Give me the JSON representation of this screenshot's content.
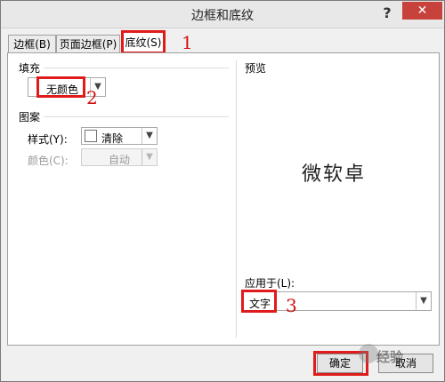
{
  "window": {
    "title": "边框和底纹",
    "help_label": "?",
    "close_label": "✕"
  },
  "tabs": [
    {
      "label": "边框(B)"
    },
    {
      "label": "页面边框(P)"
    },
    {
      "label": "底纹(S)"
    }
  ],
  "markers": {
    "m1": "1",
    "m2": "2",
    "m3": "3"
  },
  "fill": {
    "label": "填充",
    "color_value": "无颜色"
  },
  "pattern": {
    "label": "图案",
    "style_label": "样式(Y):",
    "style_value": "清除",
    "color_label": "颜色(C):",
    "color_value": "自动"
  },
  "preview": {
    "label": "预览",
    "sample_text": "微软卓"
  },
  "apply": {
    "label": "应用于(L):",
    "value": "文字"
  },
  "buttons": {
    "ok": "确定",
    "cancel": "取消"
  },
  "watermark": "经验",
  "colors": {
    "highlight": "#e01b1b",
    "close": "#c7423a"
  }
}
